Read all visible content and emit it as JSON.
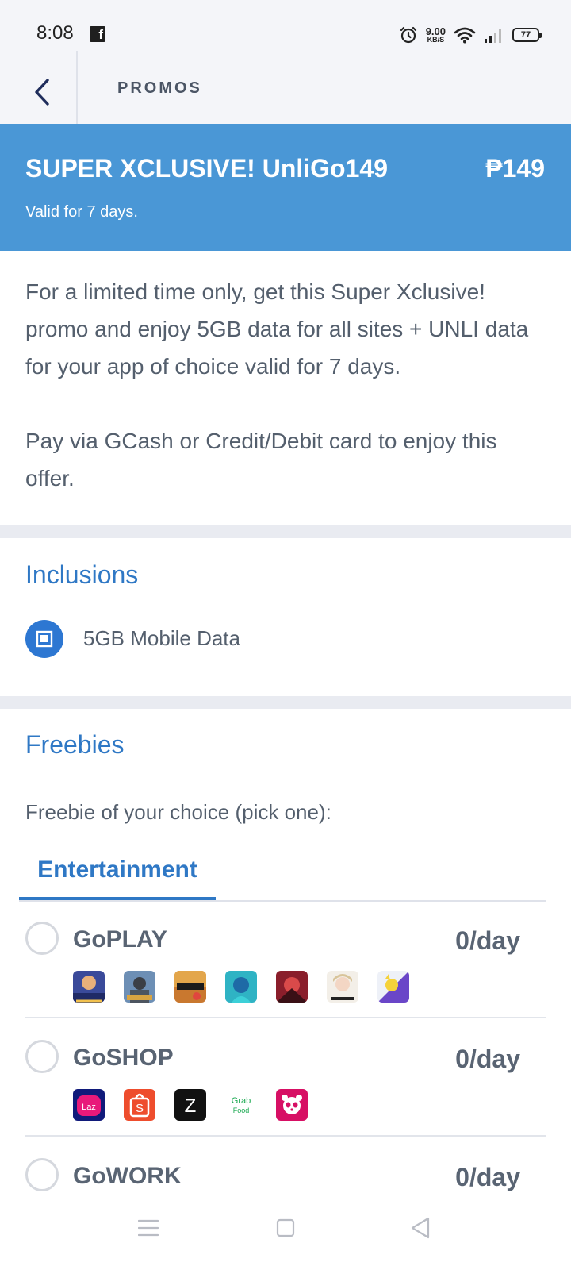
{
  "status_bar": {
    "time": "8:08",
    "network_speed_value": "9.00",
    "network_speed_unit": "KB/S",
    "battery_level": "77"
  },
  "header": {
    "title": "PROMOS"
  },
  "promo": {
    "name": "SUPER XCLUSIVE! UnliGo149",
    "price": "₱149",
    "validity": "Valid for 7 days.",
    "banner_color": "#4a97d6"
  },
  "description": {
    "paragraph1": "For a limited time only, get this Super Xclusive! promo and enjoy 5GB data for all sites + UNLI data for your app of choice valid for 7 days.",
    "paragraph2": "Pay via GCash or Credit/Debit card to enjoy this offer."
  },
  "inclusions": {
    "title": "Inclusions",
    "items": [
      {
        "label": "5GB Mobile Data",
        "icon": "mobile-data-icon"
      }
    ]
  },
  "freebies": {
    "title": "Freebies",
    "subtitle": "Freebie of your choice (pick one):",
    "tabs": [
      {
        "label": "Entertainment",
        "selected": true
      }
    ],
    "options": [
      {
        "name": "GoPLAY",
        "rate": "0/day",
        "apps": [
          "mobile-legends-icon",
          "pubg-icon",
          "call-of-duty-icon",
          "arena-game-icon",
          "action-game-icon",
          "anime-game-icon",
          "pokemon-game-icon"
        ]
      },
      {
        "name": "GoSHOP",
        "rate": "0/day",
        "apps": [
          "lazada-icon",
          "shopee-icon",
          "zalora-icon",
          "grabfood-icon",
          "foodpanda-icon"
        ],
        "app_text": {
          "lazada": "Laz",
          "shopee": "S",
          "zalora": "Z",
          "grab": "Grab",
          "food": "Food"
        }
      },
      {
        "name": "GoWORK",
        "rate": "0/day"
      }
    ]
  },
  "colors": {
    "accent": "#2f78c5",
    "text": "#545f6d"
  }
}
